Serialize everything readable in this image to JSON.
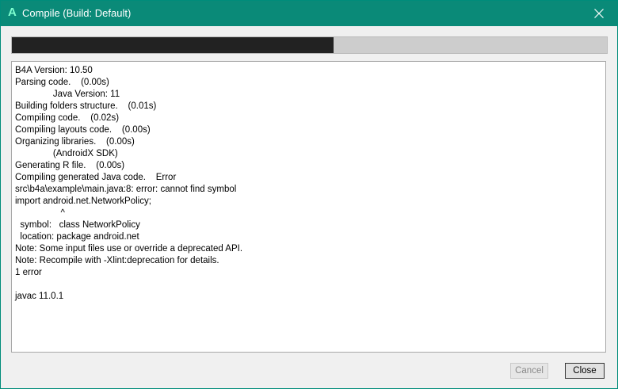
{
  "window": {
    "app_icon": "A",
    "title": "Compile (Build: Default)",
    "close_icon": "close-icon"
  },
  "progress": {
    "value_percent": 54
  },
  "log": {
    "lines": [
      "B4A Version: 10.50",
      "Parsing code.    (0.00s)",
      "               Java Version: 11",
      "Building folders structure.    (0.01s)",
      "Compiling code.    (0.02s)",
      "Compiling layouts code.    (0.00s)",
      "Organizing libraries.    (0.00s)",
      "               (AndroidX SDK)",
      "Generating R file.    (0.00s)",
      "Compiling generated Java code.    Error",
      "src\\b4a\\example\\main.java:8: error: cannot find symbol",
      "import android.net.NetworkPolicy;",
      "                  ^",
      "  symbol:   class NetworkPolicy",
      "  location: package android.net",
      "Note: Some input files use or override a deprecated API.",
      "Note: Recompile with -Xlint:deprecation for details.",
      "1 error",
      "",
      "javac 11.0.1"
    ]
  },
  "buttons": {
    "cancel_label": "Cancel",
    "close_label": "Close"
  },
  "colors": {
    "titlebar": "#0a8a78",
    "progress_fill": "#222222",
    "progress_track": "#cdcdcd"
  }
}
